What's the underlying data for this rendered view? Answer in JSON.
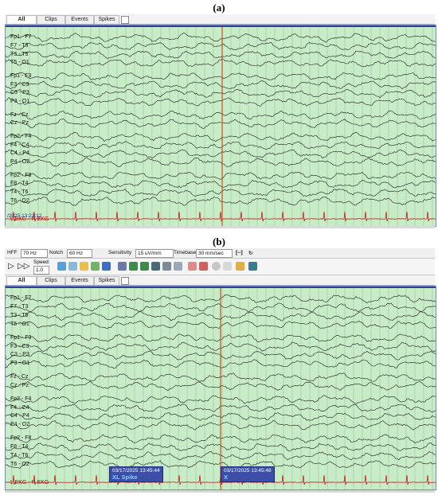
{
  "panels": [
    {
      "label": "(a)",
      "tabs": [
        "All",
        "Clips",
        "Events",
        "Spikes"
      ],
      "channel_groups": [
        [
          "Fp1 - F7",
          "F7 - T3",
          "T3 - T5",
          "T5 - O1"
        ],
        [
          "Fp1 - F3",
          "F3 - C3",
          "C3 - P3",
          "P3 - O1"
        ],
        [
          "Fz - Cz",
          "Cz - Pz"
        ],
        [
          "Fp2 - F4",
          "F4 - C4",
          "C4 - P4",
          "P4 - O2"
        ],
        [
          "Fp2 - F8",
          "F8 - T4",
          "T4 - T6",
          "T6 - O2"
        ]
      ],
      "timestamp": "/2025 13:23:12",
      "ekg_label": "L EKG - R EKG"
    },
    {
      "label": "(b)",
      "tabs": [
        "All",
        "Clips",
        "Events",
        "Spikes"
      ],
      "channel_groups": [
        [
          "Fp1 - F7",
          "F7 - T3",
          "T3 - T5",
          "T5 - O1"
        ],
        [
          "Fp1 - F3",
          "F3 - C3",
          "C3 - P3",
          "P3 - O1"
        ],
        [
          "Fz - Cz",
          "Cz - Pz"
        ],
        [
          "Fp2 - F4",
          "F4 - C4",
          "C4 - P4",
          "P4 - O2"
        ],
        [
          "Fp2 - F8",
          "F8 - T4",
          "T4 - T6",
          "T6 - O2"
        ]
      ],
      "ekg_label": "L EKG - R EKG",
      "events": [
        {
          "time": "03/17/2025 13:45:44",
          "title": "XL Spike"
        },
        {
          "time": "03/17/2025 13:45:48",
          "title": "X"
        }
      ]
    }
  ],
  "toolbar": {
    "hff_label": "HFF",
    "hff_value": "70 Hz",
    "notch_label": "Notch",
    "notch_value": "60 Hz",
    "sensitivity_label": "Sensitivity",
    "sensitivity_value": "15 uV/mm",
    "timebase_label": "Timebase",
    "timebase_value": "30 mm/sec",
    "speed_label": "Speed:",
    "speed_value": "1.0"
  },
  "colors": {
    "background": "#c9ecc8",
    "trace": "#1a1a1a",
    "ekg": "#c00000",
    "cursor": "#c8531e",
    "frame": "#2d3e9c"
  }
}
